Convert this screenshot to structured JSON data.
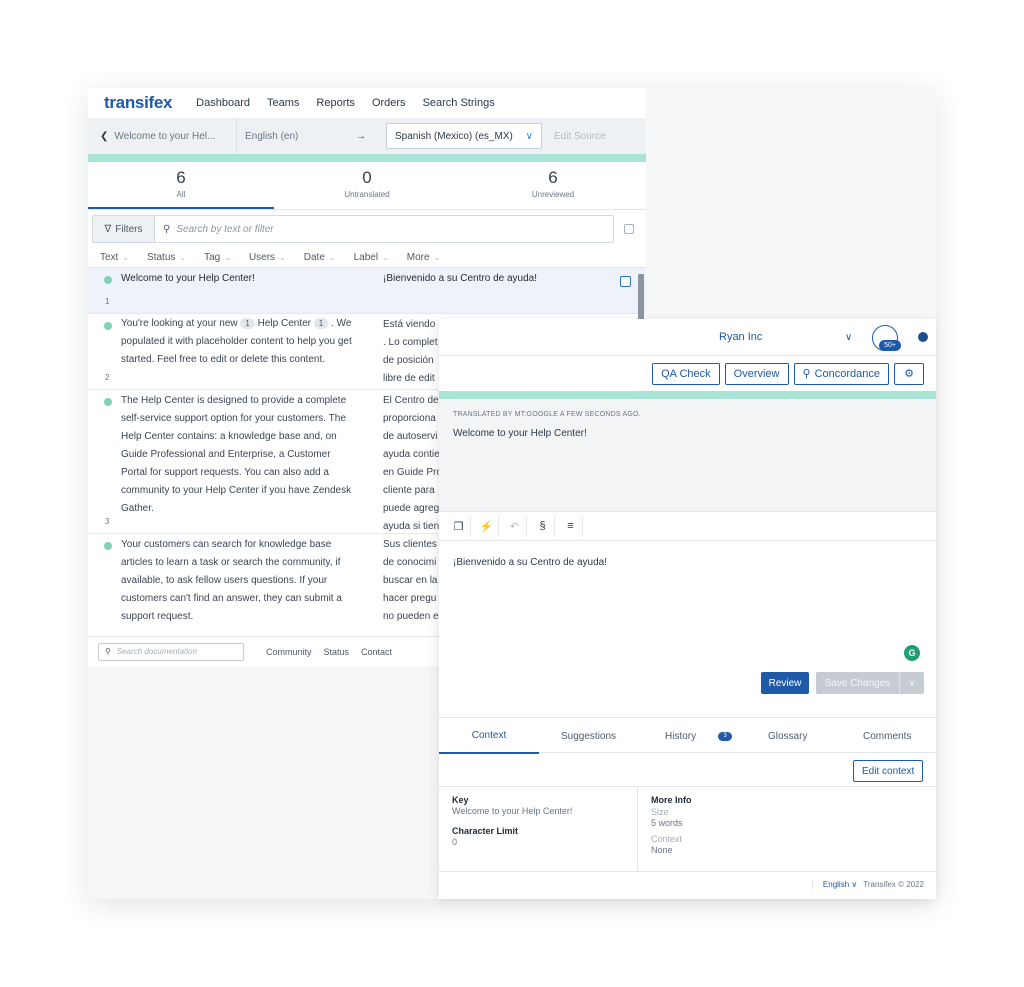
{
  "app": {
    "logo": "transifex",
    "nav": [
      "Dashboard",
      "Teams",
      "Reports",
      "Orders",
      "Search Strings"
    ]
  },
  "langbar": {
    "back_label": "Welcome to your Hel...",
    "source_lang": "English (en)",
    "arrow": "→",
    "target_lang": "Spanish (Mexico) (es_MX)",
    "edit_source": "Edit Source"
  },
  "stats": [
    {
      "num": "6",
      "label": "All"
    },
    {
      "num": "0",
      "label": "Untranslated"
    },
    {
      "num": "6",
      "label": "Unreviewed"
    }
  ],
  "filters": {
    "button": "Filters",
    "placeholder": "Search by text or filter",
    "columns": [
      "Text",
      "Status",
      "Tag",
      "Users",
      "Date",
      "Label",
      "More"
    ]
  },
  "rows": [
    {
      "src": "Welcome to your Help Center!",
      "tgt": "¡Bienvenido a su Centro de ayuda!",
      "num": "1"
    },
    {
      "src_a": "You're looking at your new",
      "chip1": "1",
      "src_b": "Help Center",
      "chip2": "1",
      "src_c": ". We populated it with placeholder content to help you get started. Feel free to edit or delete this content.",
      "tgt": "Está viendo\n. Lo complet\nde posición\nlibre de edit",
      "num": "2"
    },
    {
      "src": "The Help Center is designed to provide a complete self-service support option for your customers. The Help Center contains: a knowledge base and, on Guide Professional and Enterprise, a Customer Portal for support requests. You can also add a community to your Help Center if you have Zendesk Gather.",
      "tgt": "El Centro de\nproporciona\nde autoservi\nayuda contie\nen Guide Pro\ncliente para\npuede agreg\nayuda si tien",
      "num": "3"
    },
    {
      "src": "Your customers can search for knowledge base articles to learn a task or search the community, if available, to ask fellow users questions. If your customers can't find an answer, they can submit a support request.",
      "tgt": "Sus clientes\nde conocimi\nbuscar en la\nhacer pregu\nno pueden e",
      "num": ""
    }
  ],
  "footer": {
    "search_placeholder": "Search documentation",
    "links": [
      "Community",
      "Status",
      "Contact"
    ]
  },
  "detail": {
    "org": "Ryan Inc",
    "avatar_badge": "50+",
    "tools": {
      "qa": "QA Check",
      "overview": "Overview",
      "concordance": "Concordance"
    },
    "mt_note": "Translated by MT:Google a few seconds ago.",
    "source_text": "Welcome to your Help Center!",
    "target_text": "¡Bienvenido a su Centro de ayuda!",
    "grammarly": "G",
    "review_btn": "Review",
    "save_btn": "Save Changes",
    "tabs": [
      "Context",
      "Suggestions",
      "History",
      "Glossary",
      "Comments"
    ],
    "history_count": "3",
    "edit_context": "Edit context",
    "info": {
      "key_h": "Key",
      "key_v": "Welcome to your Help Center!",
      "limit_h": "Character Limit",
      "limit_v": "0",
      "more_h": "More Info",
      "size_label": "Size",
      "size_v": "5 words",
      "context_label": "Context",
      "context_v": "None"
    },
    "footer_lang": "English",
    "copyright": "Transifex © 2022"
  },
  "colors": {
    "brand": "#1e5aa8",
    "teal": "#a9e4d6",
    "status_dot": "#7fd2b8"
  }
}
